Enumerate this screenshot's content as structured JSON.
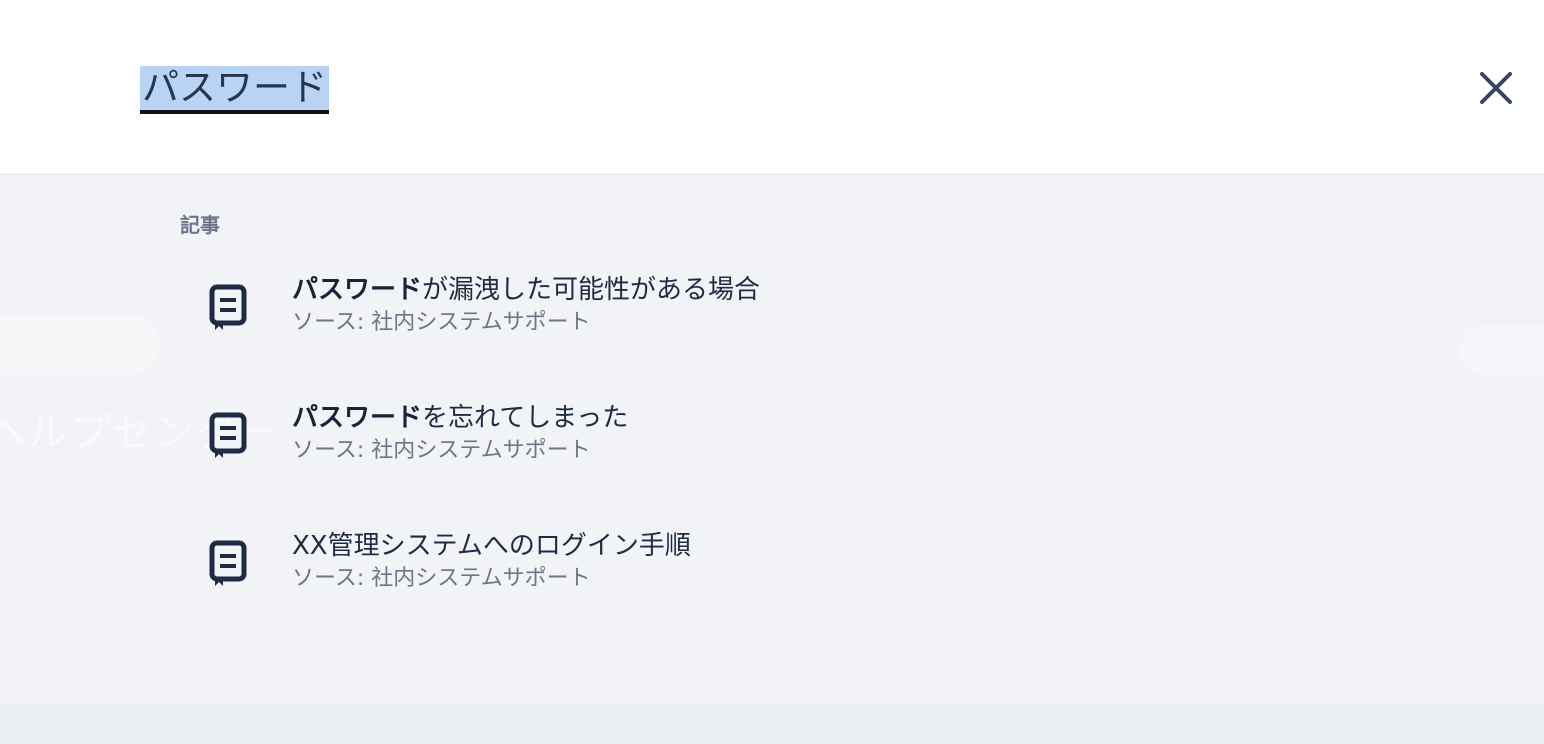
{
  "search": {
    "query": "パスワード"
  },
  "background": {
    "hero_text": "ヘルプセンター"
  },
  "results": {
    "section_label": "記事",
    "items": [
      {
        "title_highlight": "パスワード",
        "title_rest": "が漏洩した可能性がある場合",
        "source": "ソース: 社内システムサポート"
      },
      {
        "title_highlight": "パスワード",
        "title_rest": "を忘れてしまった",
        "source": "ソース: 社内システムサポート"
      },
      {
        "title_highlight": "",
        "title_rest": "XX管理システムへのログイン手順",
        "source": "ソース: 社内システムサポート"
      }
    ]
  },
  "icons": {
    "close": "close-icon",
    "article": "article-icon"
  },
  "colors": {
    "text_primary": "#1f2a44",
    "text_secondary": "#6d7587",
    "selection": "#b8d3f3",
    "results_bg": "#f1f3f6"
  }
}
